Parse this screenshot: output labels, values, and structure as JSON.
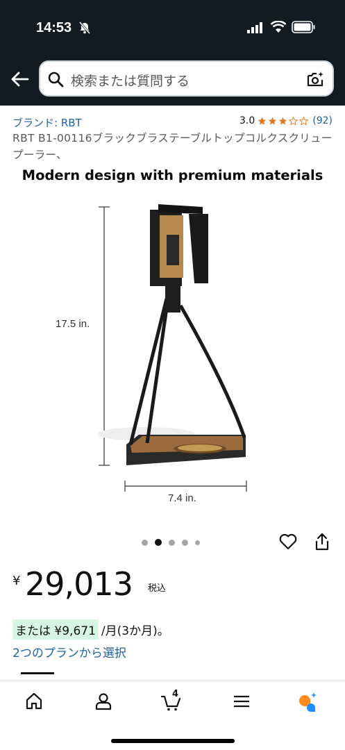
{
  "status_bar": {
    "time": "14:53"
  },
  "search": {
    "placeholder": "検索または質問する"
  },
  "product": {
    "brand": "ブランド: RBT",
    "rating": "3.0",
    "rating_stars": 3,
    "review_count": "(92)",
    "title": "RBT B1-00116ブラックブラステーブルトップコルクスクリュープーラー、",
    "image_caption": "Modern design with premium materials",
    "dimension_height": "17.5 in.",
    "dimension_width": "7.4 in.",
    "image_index": 2,
    "image_count": 5
  },
  "price": {
    "currency": "¥",
    "value": "29,013",
    "tax_note": "税込",
    "installment_prefix": "または",
    "installment_amount": "¥9,671",
    "installment_suffix": "/月(3か月)。",
    "plans_link": "2つのプランから選択"
  },
  "bottom_nav": {
    "items": [
      "home-icon",
      "account-icon",
      "cart-icon",
      "menu-icon",
      "rufus-icon"
    ],
    "cart_count": "4"
  },
  "colors": {
    "header_bg": "#131a22",
    "link": "#2162a1",
    "star": "#de7921",
    "highlight": "#d6f5e3"
  }
}
